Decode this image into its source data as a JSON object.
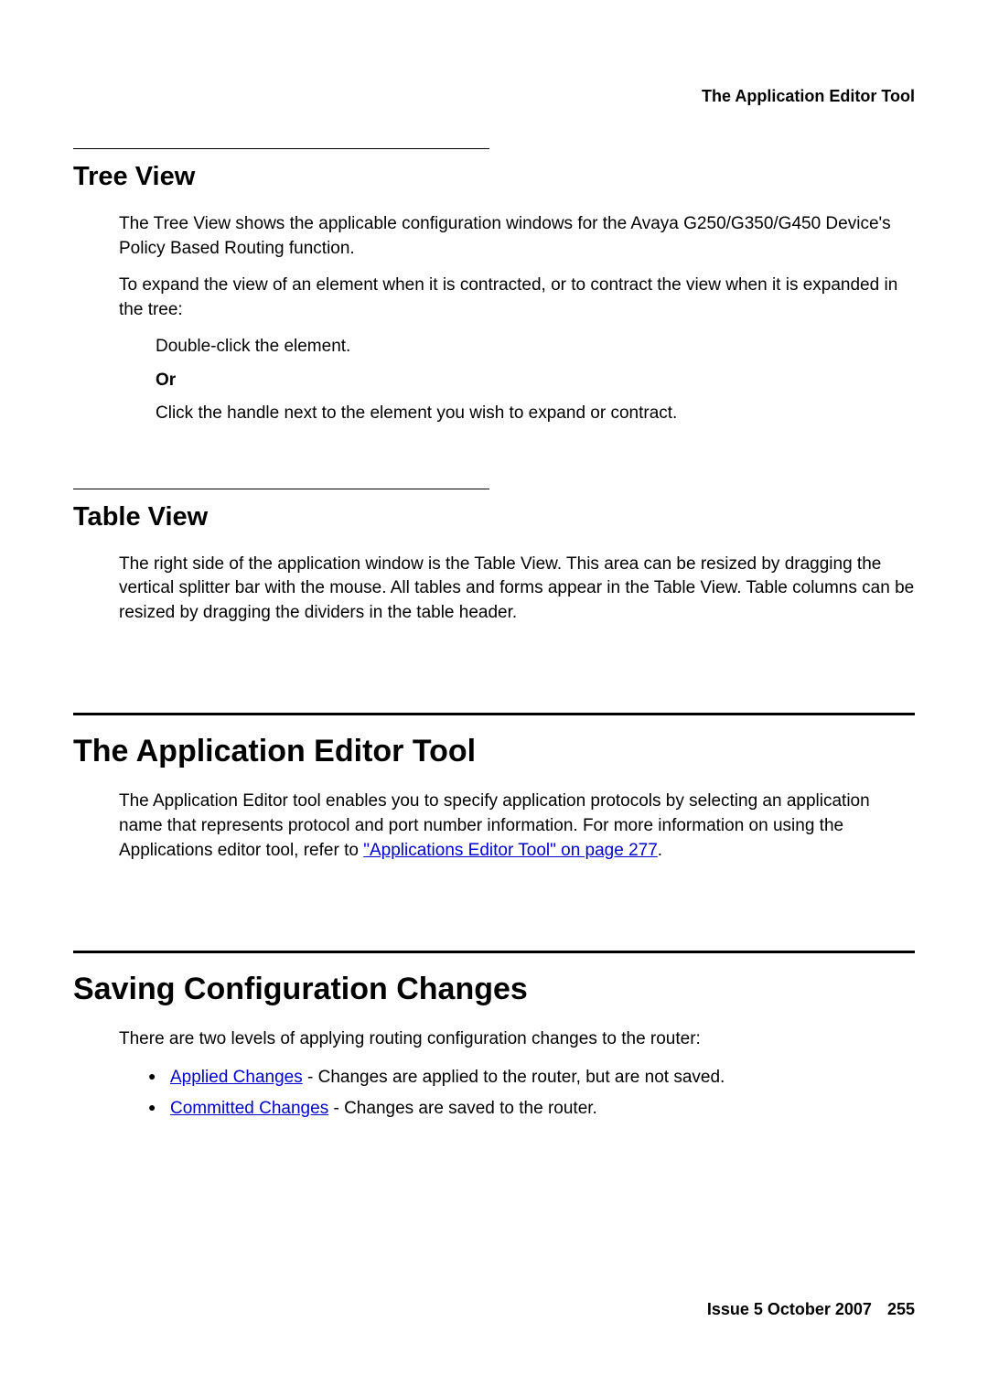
{
  "header": {
    "title": "The Application Editor Tool"
  },
  "sections": {
    "tree_view": {
      "heading": "Tree View",
      "para1": "The Tree View shows the applicable configuration windows for the Avaya G250/G350/G450 Device's Policy Based Routing function.",
      "para2": "To expand the view of an element when it is contracted, or to contract the view when it is expanded in the tree:",
      "step1": "Double-click the element.",
      "or": "Or",
      "step2": "Click the handle next to the element you wish to expand or contract."
    },
    "table_view": {
      "heading": "Table View",
      "para1": "The right side of the application window is the Table View. This area can be resized by dragging the vertical splitter bar with the mouse. All tables and forms appear in the Table View. Table columns can be resized by dragging the dividers in the table header."
    },
    "app_editor": {
      "heading": "The Application Editor Tool",
      "para1_pre": "The Application Editor tool enables you to specify application protocols by selecting an application name that represents protocol and port number information. For more information on using the Applications editor tool, refer to ",
      "link": "\"Applications Editor Tool\" on page 277",
      "para1_post": "."
    },
    "saving": {
      "heading": "Saving Configuration Changes",
      "para1": "There are two levels of applying routing configuration changes to the router:",
      "bullet1_link": "Applied Changes",
      "bullet1_text": " - Changes are applied to the router, but are not saved.",
      "bullet2_link": "Committed Changes",
      "bullet2_text": " - Changes are saved to the router."
    }
  },
  "footer": {
    "issue": "Issue 5   October 2007",
    "page": "255"
  }
}
